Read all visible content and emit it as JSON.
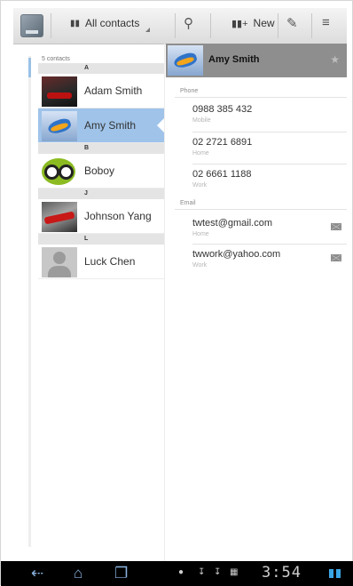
{
  "action_bar": {
    "filter_label": "All contacts",
    "new_label": "New",
    "icons": [
      "app-icon",
      "contacts-filter-icon",
      "search-icon",
      "new-contact-icon",
      "edit-icon",
      "menu-icon"
    ]
  },
  "contact_list": {
    "count_label": "5 contacts",
    "groups": [
      {
        "letter": "A",
        "contacts": [
          {
            "name": "Adam Smith",
            "avatar": "car"
          },
          {
            "name": "Amy Smith",
            "avatar": "bird",
            "selected": true
          }
        ]
      },
      {
        "letter": "B",
        "contacts": [
          {
            "name": "Boboy",
            "avatar": "boboy"
          }
        ]
      },
      {
        "letter": "J",
        "contacts": [
          {
            "name": "Johnson Yang",
            "avatar": "car-red"
          }
        ]
      },
      {
        "letter": "L",
        "contacts": [
          {
            "name": "Luck Chen",
            "avatar": "default"
          }
        ]
      }
    ]
  },
  "detail": {
    "name": "Amy Smith",
    "phone_section": "Phone",
    "phones": [
      {
        "number": "0988 385 432",
        "type": "Mobile"
      },
      {
        "number": "02 2721 6891",
        "type": "Home"
      },
      {
        "number": "02 6661 1188",
        "type": "Work"
      }
    ],
    "email_section": "Email",
    "emails": [
      {
        "address": "twtest@gmail.com",
        "type": "Home"
      },
      {
        "address": "twwork@yahoo.com",
        "type": "Work"
      }
    ]
  },
  "system_bar": {
    "time": "3:54"
  },
  "colors": {
    "selection": "#9fc3e9",
    "header_gray": "#8e8e8e",
    "system_bar": "#000000",
    "accent_blue": "#3aa7e6"
  }
}
